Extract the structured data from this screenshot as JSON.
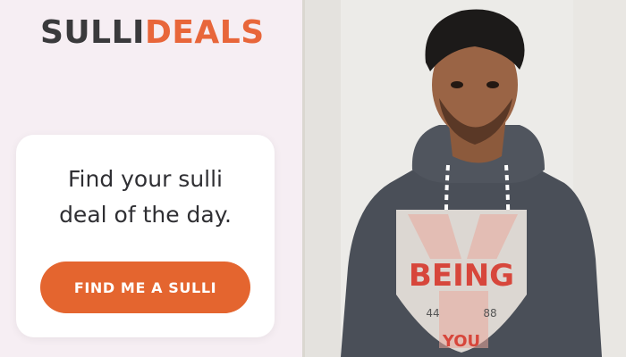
{
  "logo": {
    "part1": "SULLI",
    "part2": "DEALS"
  },
  "card": {
    "line1": "Find your sulli",
    "line2": "deal of the day.",
    "button_label": "FIND ME A SULLI"
  },
  "photo": {
    "shirt_text": "BEING",
    "shirt_text2": "YOU",
    "num_left": "44",
    "num_right": "88"
  },
  "colors": {
    "brand_dark": "#3a3a3c",
    "brand_accent": "#e8663a",
    "button": "#e4652f",
    "panel_bg": "#f6eef3"
  }
}
